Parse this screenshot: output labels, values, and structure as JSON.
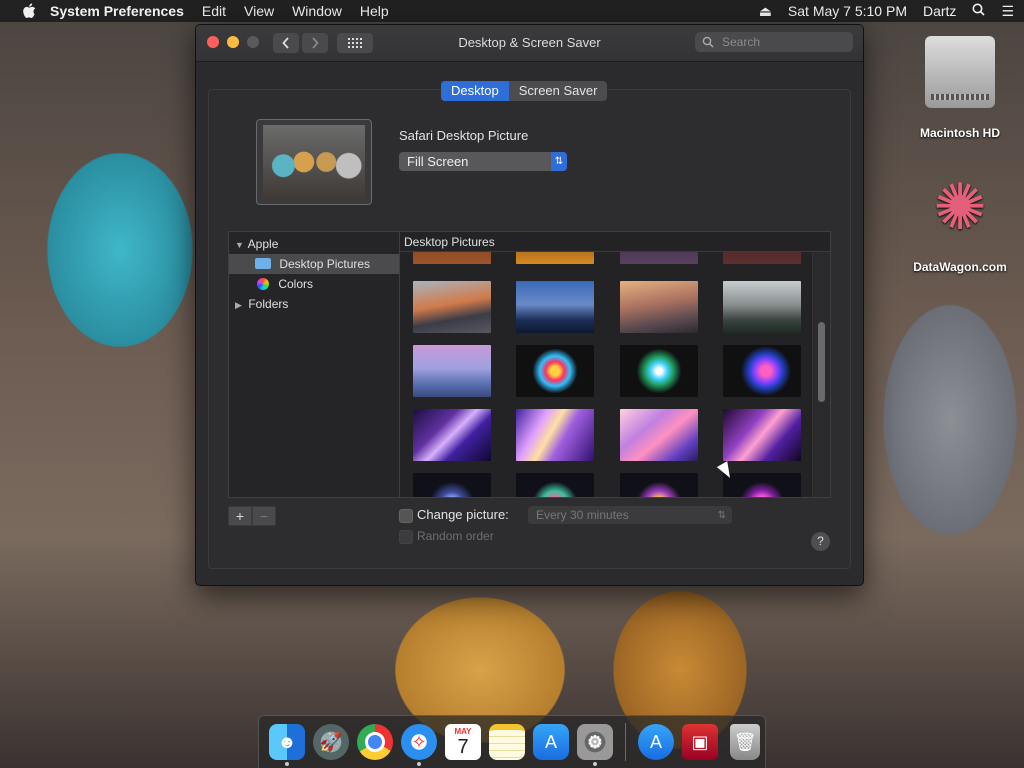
{
  "menubar": {
    "app_name": "System Preferences",
    "menus": [
      "Edit",
      "View",
      "Window",
      "Help"
    ],
    "datetime": "Sat May 7  5:10 PM",
    "user": "Dartz"
  },
  "window": {
    "title": "Desktop & Screen Saver",
    "search_placeholder": "Search",
    "tabs": [
      {
        "label": "Desktop",
        "active": true
      },
      {
        "label": "Screen Saver",
        "active": false
      }
    ],
    "picture_title": "Safari Desktop Picture",
    "fit_option": "Fill Screen",
    "sidebar": {
      "group": "Apple",
      "items": [
        "Desktop Pictures",
        "Colors"
      ],
      "folders": "Folders"
    },
    "gallery_header": "Desktop Pictures",
    "change_picture_label": "Change picture:",
    "interval_value": "Every 30 minutes",
    "random_order_label": "Random order",
    "add_label": "+",
    "remove_label": "−",
    "help_label": "?"
  },
  "desktop": {
    "icons": [
      "Macintosh HD",
      "DataWagon.com"
    ]
  },
  "dock": {
    "calendar_month": "MAY",
    "calendar_day": "7"
  },
  "colors": {
    "accent": "#2f6ed9",
    "close": "#fc605c",
    "minimize": "#fdbc40"
  }
}
